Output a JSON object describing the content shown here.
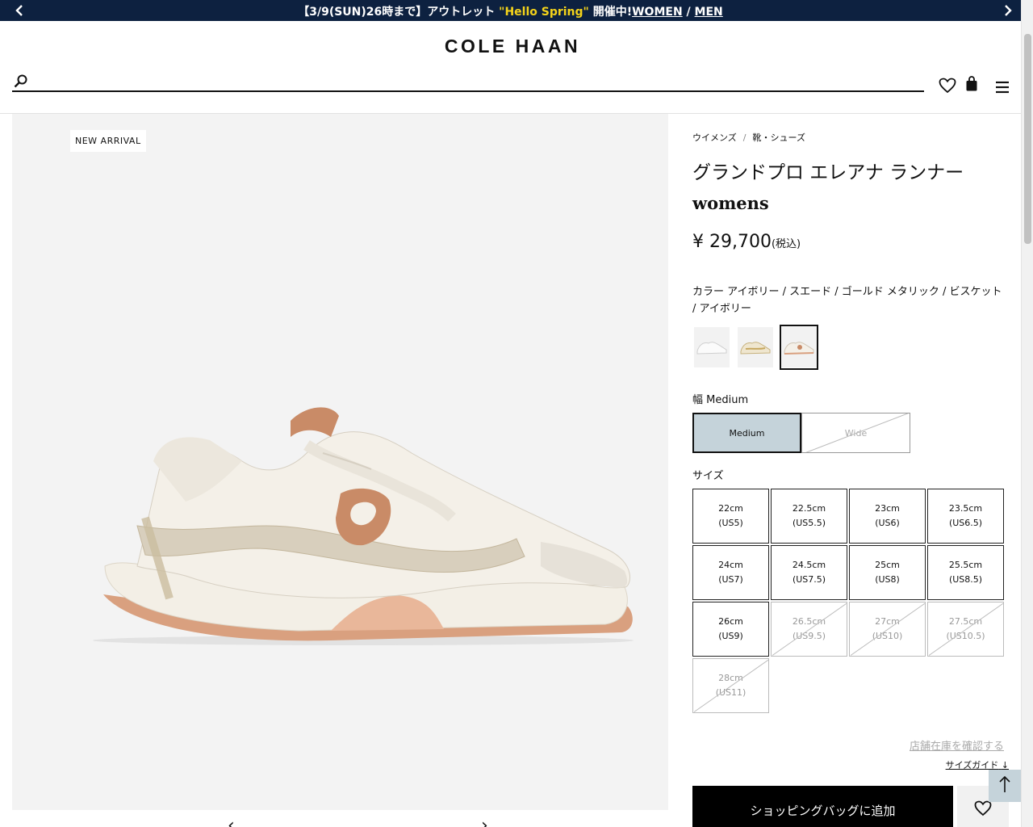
{
  "promo": {
    "prefix": "【3/9(SUN)26時まで】アウトレット ",
    "highlight": "\"Hello Spring\"",
    "middle": " 開催中!",
    "link_women": "WOMEN",
    "divider": " / ",
    "link_men": "MEN",
    "bg_color": "#0d2140",
    "highlight_color": "#f4d31a"
  },
  "header": {
    "logo": "COLE HAAN",
    "search_placeholder": "",
    "icons": [
      "search-icon",
      "heart-icon",
      "bag-icon",
      "menu-icon"
    ]
  },
  "gallery": {
    "badge": "NEW ARRIVAL",
    "prev": "‹",
    "next": "›"
  },
  "product": {
    "breadcrumbs": [
      "ウイメンズ",
      "靴・シューズ"
    ],
    "breadcrumb_sep": "/",
    "title": "グランドプロ エレアナ ランナー",
    "subtitle": "womens",
    "price": "¥ 29,700",
    "price_tax": "(税込)",
    "color_label": "カラー アイボリー / スエード / ゴールド メタリック / ビスケット / アイボリー",
    "swatches": [
      {
        "name": "white",
        "selected": false
      },
      {
        "name": "gold",
        "selected": false
      },
      {
        "name": "ivory-biscuit",
        "selected": true
      }
    ],
    "width_label": "幅 Medium",
    "widths": [
      {
        "label": "Medium",
        "selected": true,
        "available": true
      },
      {
        "label": "Wide",
        "selected": false,
        "available": false
      }
    ],
    "size_label": "サイズ",
    "sizes": [
      {
        "cm": "22cm",
        "us": "(US5)",
        "available": true
      },
      {
        "cm": "22.5cm",
        "us": "(US5.5)",
        "available": true
      },
      {
        "cm": "23cm",
        "us": "(US6)",
        "available": true
      },
      {
        "cm": "23.5cm",
        "us": "(US6.5)",
        "available": true
      },
      {
        "cm": "24cm",
        "us": "(US7)",
        "available": true
      },
      {
        "cm": "24.5cm",
        "us": "(US7.5)",
        "available": true
      },
      {
        "cm": "25cm",
        "us": "(US8)",
        "available": true
      },
      {
        "cm": "25.5cm",
        "us": "(US8.5)",
        "available": true
      },
      {
        "cm": "26cm",
        "us": "(US9)",
        "available": true
      },
      {
        "cm": "26.5cm",
        "us": "(US9.5)",
        "available": false
      },
      {
        "cm": "27cm",
        "us": "(US10)",
        "available": false
      },
      {
        "cm": "27.5cm",
        "us": "(US10.5)",
        "available": false
      },
      {
        "cm": "28cm",
        "us": "(US11)",
        "available": false
      }
    ],
    "store_stock_link": "店舗在庫を確認する",
    "size_guide_link": "サイズガイド",
    "size_guide_arrow": "↓",
    "add_to_bag": "ショッピングバッグに追加"
  }
}
